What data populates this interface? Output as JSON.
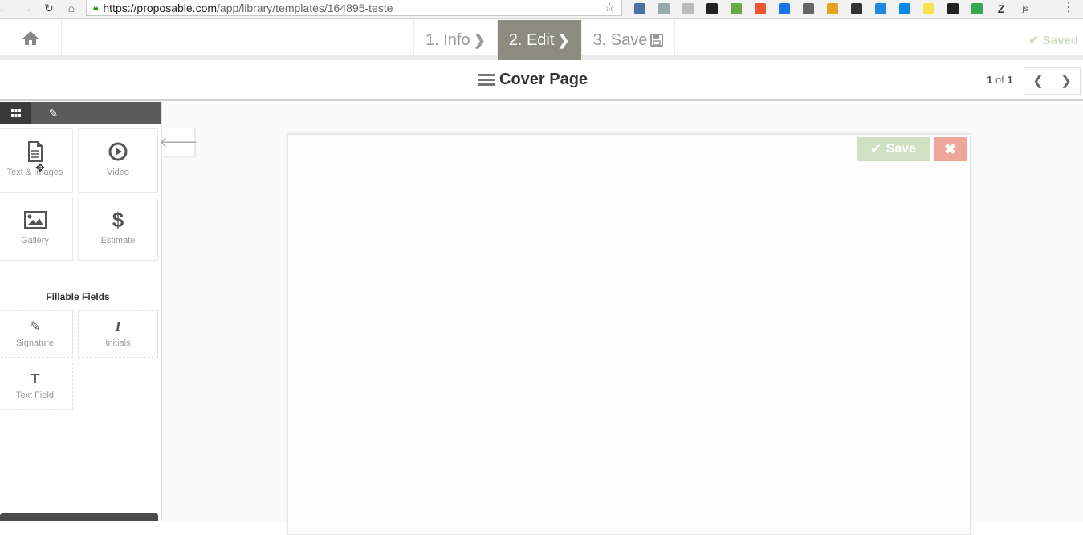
{
  "browser": {
    "url_host": "https://proposable.com",
    "url_path": "/app/library/templates/164895-teste",
    "extensions": [
      "#4a6fa5",
      "#9aa",
      "#bbb",
      "#222",
      "#6a4",
      "#e53",
      "#1a73e8",
      "#666",
      "#e7a21e",
      "#333",
      "#1e88e5",
      "#0a8ae6",
      "#f7e34d",
      "#222",
      "#34a853",
      "#333",
      "#555"
    ],
    "extension_z": "Z",
    "extension_js": "js"
  },
  "header": {
    "steps": [
      {
        "label": "1. Info",
        "icon": "chevron-right-icon"
      },
      {
        "label": "2. Edit",
        "icon": "chevron-right-icon"
      },
      {
        "label": "3. Save",
        "icon": "floppy-disk-icon"
      }
    ],
    "saved_label": "Saved"
  },
  "titlebar": {
    "title": "Cover Page",
    "pager_current": "1",
    "pager_of": "of",
    "pager_total": "1"
  },
  "sidebar": {
    "tabs": [
      {
        "icon": "grid-icon"
      },
      {
        "icon": "paperclip-icon"
      }
    ],
    "blocks": [
      {
        "label": "Text & Images",
        "icon": "document-icon"
      },
      {
        "label": "Video",
        "icon": "play-icon"
      },
      {
        "label": "Gallery",
        "icon": "image-icon"
      },
      {
        "label": "Estimate",
        "icon": "dollar-icon"
      }
    ],
    "fillable_heading": "Fillable Fields",
    "fields": [
      {
        "label": "Signature",
        "icon": "pencil-icon"
      },
      {
        "label": "Initials",
        "icon": "italic-icon"
      },
      {
        "label": "Text Field",
        "icon": "text-icon"
      }
    ]
  },
  "editor": {
    "save_label": "Save",
    "colors": {
      "save": "#cfe1c2",
      "close": "#eea69b",
      "active_step": "#8b8b80"
    }
  }
}
